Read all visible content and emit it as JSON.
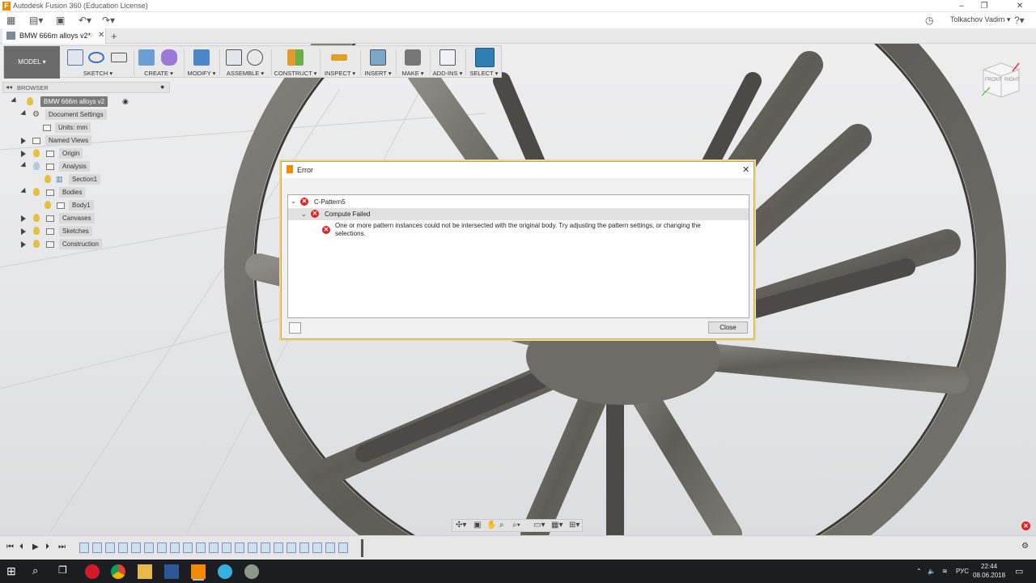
{
  "window": {
    "title": "Autodesk Fusion 360 (Education License)"
  },
  "user": {
    "name": "Tolkachov Vadim ▾"
  },
  "doc_tab": {
    "label": "BMW 666m alloys v2*"
  },
  "toolbar": {
    "mode": "MODEL ▾",
    "groups": [
      "SKETCH ▾",
      "CREATE ▾",
      "MODIFY ▾",
      "ASSEMBLE ▾",
      "CONSTRUCT ▾",
      "INSPECT ▾",
      "INSERT ▾",
      "MAKE ▾",
      "ADD-INS ▾",
      "SELECT ▾"
    ]
  },
  "browser": {
    "title": "BROWSER",
    "items": [
      {
        "label": "BMW 666m alloys v2"
      },
      {
        "label": "Document Settings"
      },
      {
        "label": "Units: mm"
      },
      {
        "label": "Named Views"
      },
      {
        "label": "Origin"
      },
      {
        "label": "Analysis"
      },
      {
        "label": "Section1"
      },
      {
        "label": "Bodies"
      },
      {
        "label": "Body1"
      },
      {
        "label": "Canvases"
      },
      {
        "label": "Sketches"
      },
      {
        "label": "Construction"
      }
    ]
  },
  "viewcube": {
    "front": "FRONT",
    "right": "RIGHT"
  },
  "dialog": {
    "title": "Error",
    "feature": "C-Pattern5",
    "status": "Compute Failed",
    "message": "One or more pattern instances could not be intersected with the original body. Try adjusting the pattern settings, or changing the selections.",
    "close_label": "Close"
  },
  "taskbar": {
    "time": "22:44",
    "date": "08.06.2018",
    "lang": "РУС"
  },
  "colors": {
    "accent": "#f28a00",
    "error": "#dd2222",
    "viewport": "#e6e7e9"
  }
}
